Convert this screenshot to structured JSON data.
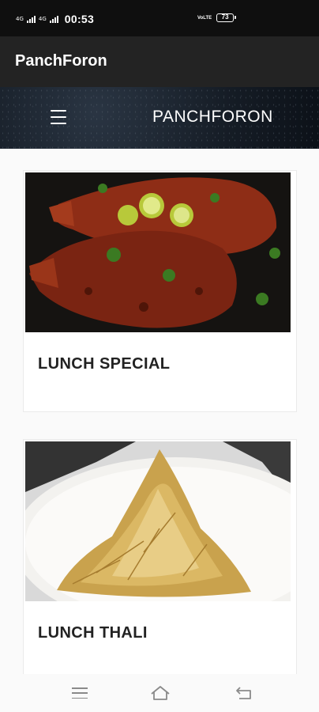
{
  "status": {
    "network_1": "4G",
    "network_2": "4G",
    "time": "00:53",
    "volte": "VoLTE",
    "battery": "73"
  },
  "app_bar": {
    "title": "PanchForon"
  },
  "site_header": {
    "menu_icon": "hamburger-icon",
    "brand": "PANCHFORON"
  },
  "menu_cards": [
    {
      "label": "LUNCH SPECIAL",
      "image": "fish-fry-photo"
    },
    {
      "label": "LUNCH THALI",
      "image": "fried-potato-shreds-photo"
    }
  ],
  "nav_bar": {
    "recents_icon": "menu-lines-icon",
    "home_icon": "home-icon",
    "back_icon": "back-icon"
  },
  "colors": {
    "status_bar": "#0f0f0f",
    "app_bar": "#232323",
    "header_bg": "#151c25",
    "page_bg": "#fafafa"
  }
}
